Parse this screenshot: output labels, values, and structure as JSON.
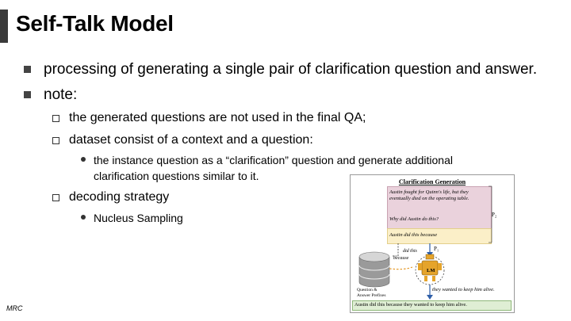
{
  "slide": {
    "title": "Self-Talk Model",
    "footer": "MRC"
  },
  "bullets": {
    "processing": "processing of generating a single pair of clarification question and answer.",
    "note": "note:",
    "generated_questions": "the generated questions are not used in the final QA;",
    "dataset": "dataset consist of a context and a question:",
    "instance_line1": "the instance question as a “clarification” question and generate additional",
    "instance_line2": "clarification questions similar to it.",
    "decoding": "decoding strategy",
    "nucleus": "Nucleus Sampling"
  },
  "figure": {
    "title": "Clarification Generation",
    "context_line1": "Austin fought for Quinn's life, but they",
    "context_line2": "eventually died on the operating table.",
    "question": "Why did Austin do this?",
    "prefix": "Austin did this because",
    "p2": "P₂",
    "p1": "P₁",
    "did_this": "did this",
    "because": "because",
    "lm": "LM",
    "db_label1": "Question &",
    "db_label2": "Answer Prefixes",
    "generated": "they wanted to keep him alive.",
    "final": "Austin did this because they wanted to keep him alive."
  },
  "colors": {
    "title_bar": "#3a3a3a",
    "context_box": "#ead2dc",
    "prefix_box": "#fbefc8",
    "output_box": "#dfeed4",
    "arrow": "#2f5fa8",
    "robot": "#e5a42b"
  }
}
